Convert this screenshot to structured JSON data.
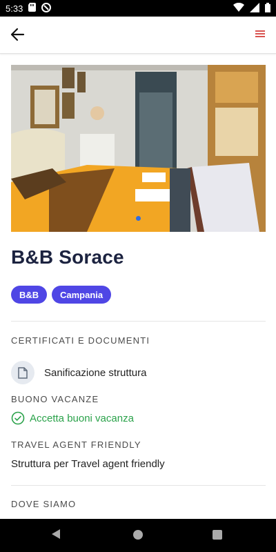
{
  "status": {
    "time": "5:33"
  },
  "property": {
    "name": "B&B Sorace",
    "tags": [
      "B&B",
      "Campania"
    ]
  },
  "certificati": {
    "label": "CERTIFICATI E DOCUMENTI",
    "item": "Sanificazione struttura"
  },
  "buono": {
    "label": "BUONO VACANZE",
    "value": "Accetta buoni vacanza"
  },
  "travel": {
    "label": "TRAVEL AGENT FRIENDLY",
    "value": "Struttura per Travel agent friendly"
  },
  "dove": {
    "label": "DOVE SIAMO"
  },
  "colors": {
    "accent": "#4f46e5",
    "success": "#2aa24a",
    "title": "#1c2340",
    "menu": "#d9534f"
  },
  "carousel": {
    "count": 1,
    "active": 1
  }
}
